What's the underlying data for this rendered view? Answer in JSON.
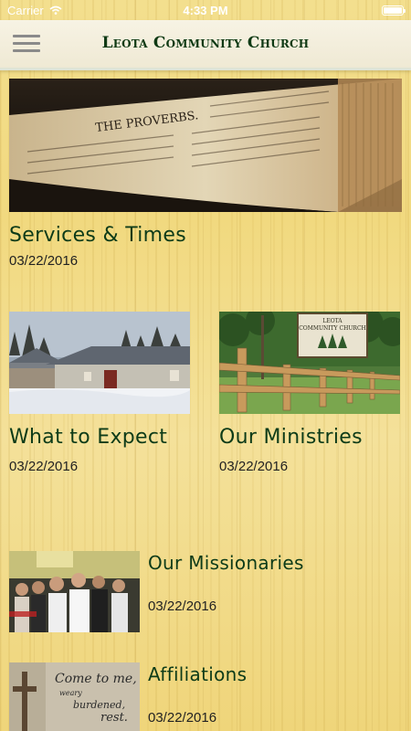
{
  "status": {
    "carrier": "Carrier",
    "time": "4:33 PM"
  },
  "header": {
    "title": "Leota Community Church"
  },
  "items": [
    {
      "title": "Services & Times",
      "date": "03/22/2016",
      "image": "bible-proverbs-photo"
    },
    {
      "title": "What to Expect",
      "date": "03/22/2016",
      "image": "church-building-winter-photo"
    },
    {
      "title": "Our Ministries",
      "date": "03/22/2016",
      "image": "church-sign-fence-photo"
    },
    {
      "title": "Our Missionaries",
      "date": "03/22/2016",
      "image": "missionaries-group-photo"
    },
    {
      "title": "Affiliations",
      "date": "03/22/2016",
      "image": "come-to-me-cross-photo"
    }
  ],
  "images": {
    "sign_text": [
      "LEOTA",
      "COMMUNITY CHURCH"
    ],
    "bible_chapter": "THE PROVERBS.",
    "wall_text": [
      "Come to me,",
      "weary",
      "burdened,",
      "rest."
    ]
  }
}
